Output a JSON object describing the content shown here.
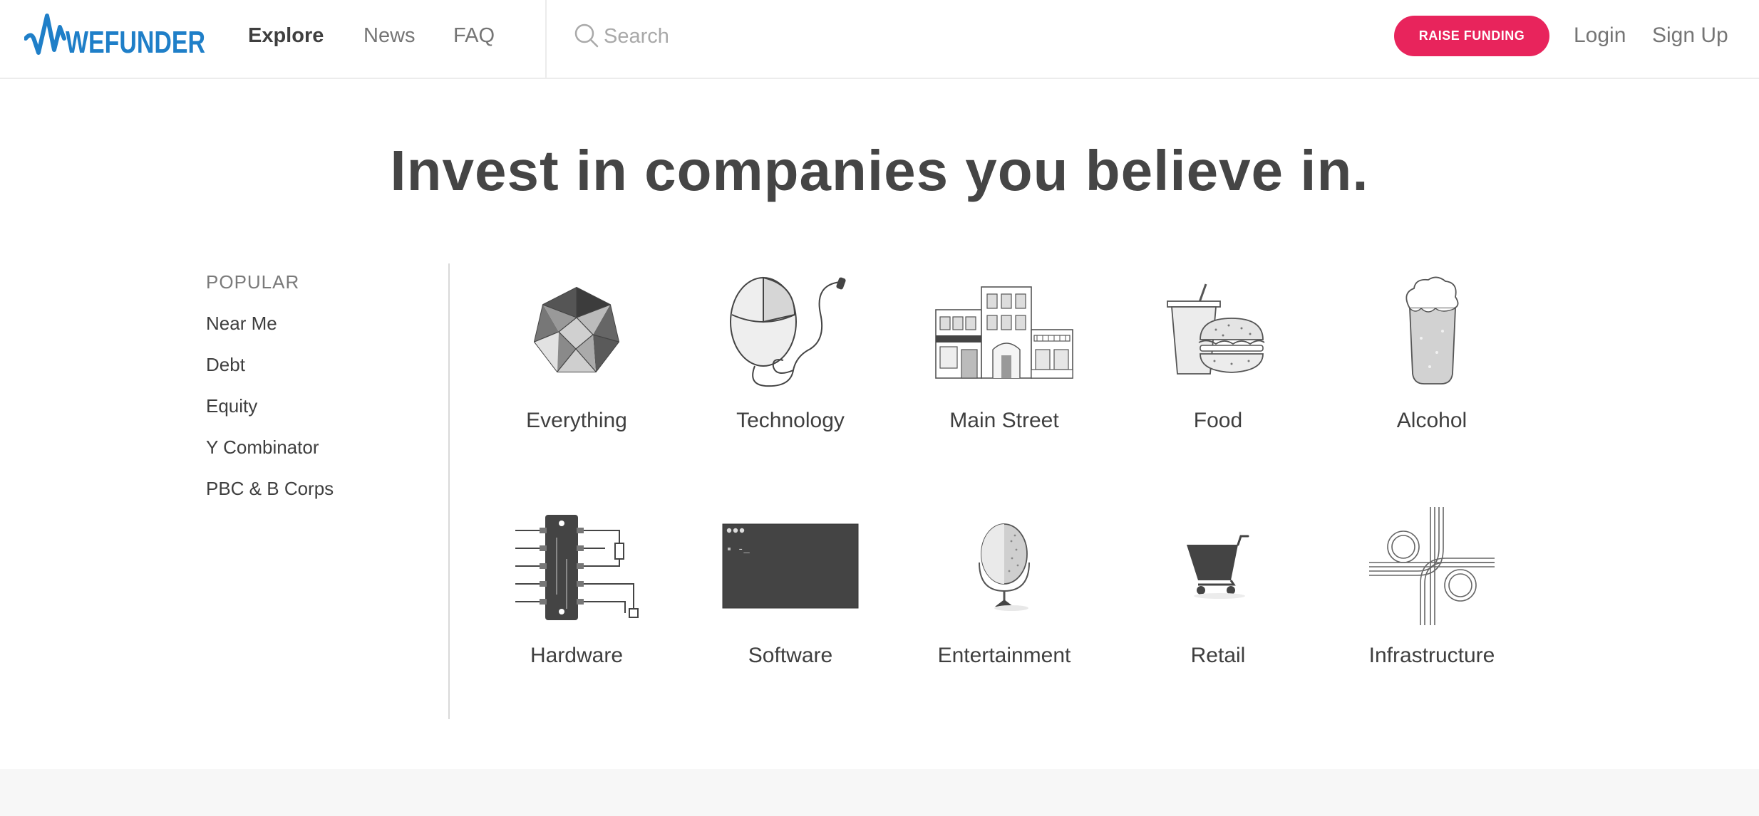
{
  "header": {
    "logo_text": "WEFUNDER",
    "nav": {
      "explore": "Explore",
      "news": "News",
      "faq": "FAQ"
    },
    "search": {
      "placeholder": "Search",
      "value": ""
    },
    "raise_button": "RAISE FUNDING",
    "login": "Login",
    "signup": "Sign Up"
  },
  "hero": {
    "title": "Invest in companies you believe in."
  },
  "sidebar": {
    "heading": "POPULAR",
    "items": [
      {
        "label": "Near Me"
      },
      {
        "label": "Debt"
      },
      {
        "label": "Equity"
      },
      {
        "label": "Y Combinator"
      },
      {
        "label": "PBC & B Corps"
      }
    ]
  },
  "categories": [
    {
      "label": "Everything",
      "icon": "polyhedron-icon"
    },
    {
      "label": "Technology",
      "icon": "computer-mouse-icon"
    },
    {
      "label": "Main Street",
      "icon": "storefront-icon"
    },
    {
      "label": "Food",
      "icon": "burger-drink-icon"
    },
    {
      "label": "Alcohol",
      "icon": "beer-glass-icon"
    },
    {
      "label": "Hardware",
      "icon": "circuit-board-icon"
    },
    {
      "label": "Software",
      "icon": "terminal-window-icon"
    },
    {
      "label": "Entertainment",
      "icon": "microphone-icon"
    },
    {
      "label": "Retail",
      "icon": "shopping-cart-icon"
    },
    {
      "label": "Infrastructure",
      "icon": "highway-interchange-icon"
    }
  ],
  "colors": {
    "brand_blue": "#1f7fc8",
    "accent_pink": "#e8245c",
    "text_dark": "#454545",
    "text_muted": "#757575"
  }
}
